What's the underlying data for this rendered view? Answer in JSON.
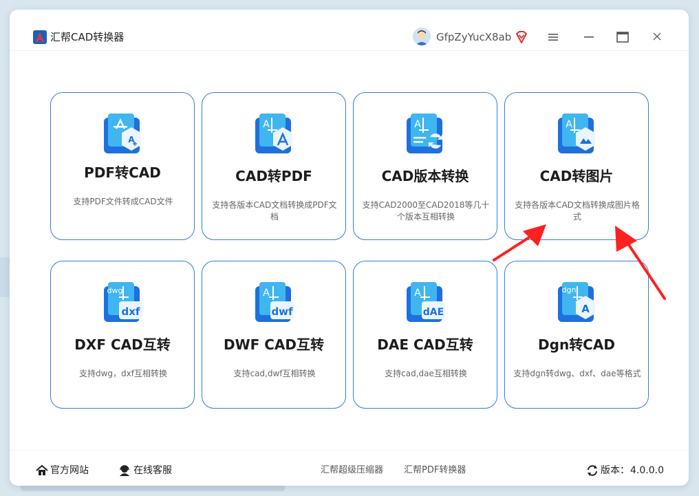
{
  "app": {
    "title": "汇帮CAD转换器",
    "username": "GfpZyYucX8ab"
  },
  "cards": [
    {
      "title": "PDF转CAD",
      "desc": "支持PDF文件转成CAD文件",
      "icon": "pdf-to-cad-icon"
    },
    {
      "title": "CAD转PDF",
      "desc": "支持各版本CAD文档转换成PDF文档",
      "icon": "cad-to-pdf-icon"
    },
    {
      "title": "CAD版本转换",
      "desc": "支持CAD2000至CAD2018等几十个版本互相转换",
      "icon": "cad-version-icon"
    },
    {
      "title": "CAD转图片",
      "desc": "支持各版本CAD文档转换成图片格式",
      "icon": "cad-to-image-icon"
    },
    {
      "title": "DXF CAD互转",
      "desc": "支持dwg，dxf互相转换",
      "icon": "dxf-icon",
      "badge": "dxf",
      "tag": "dwg"
    },
    {
      "title": "DWF CAD互转",
      "desc": "支持cad,dwf互相转换",
      "icon": "dwf-icon",
      "badge": "dwf"
    },
    {
      "title": "DAE CAD互转",
      "desc": "支持cad,dae互相转换",
      "icon": "dae-icon",
      "badge": "dAE"
    },
    {
      "title": "Dgn转CAD",
      "desc": "支持dgn转dwg、dxf、dae等格式",
      "icon": "dgn-icon",
      "badge": "A",
      "tag": "dgn"
    }
  ],
  "footer": {
    "website": "官方网站",
    "support": "在线客服",
    "link1": "汇帮超级压缩器",
    "link2": "汇帮PDF转换器",
    "version_label": "版本：",
    "version": "4.0.0.0"
  },
  "colors": {
    "accent": "#2f7ee0",
    "arrow": "#ff2020"
  }
}
